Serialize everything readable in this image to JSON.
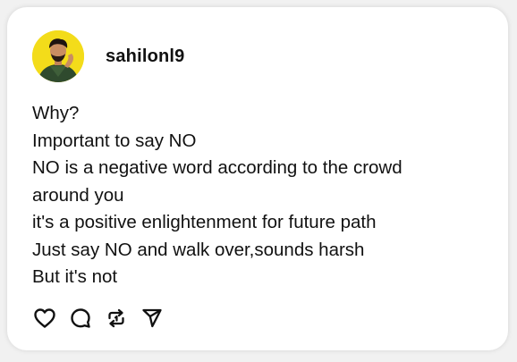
{
  "post": {
    "username": "sahilonl9",
    "lines": [
      "Why?",
      "Important to say NO",
      "NO is a negative word according to the crowd",
      "around you",
      "it's a positive enlightenment for future path",
      "Just say NO and walk over,sounds harsh",
      "But it's not"
    ]
  },
  "actions": {
    "icons": [
      "heart-icon",
      "comment-icon",
      "repost-icon",
      "share-icon"
    ]
  },
  "colors": {
    "avatar_bg": "#f3dc1a",
    "text": "#111111",
    "card": "#ffffff",
    "background": "#f1f1f1"
  }
}
